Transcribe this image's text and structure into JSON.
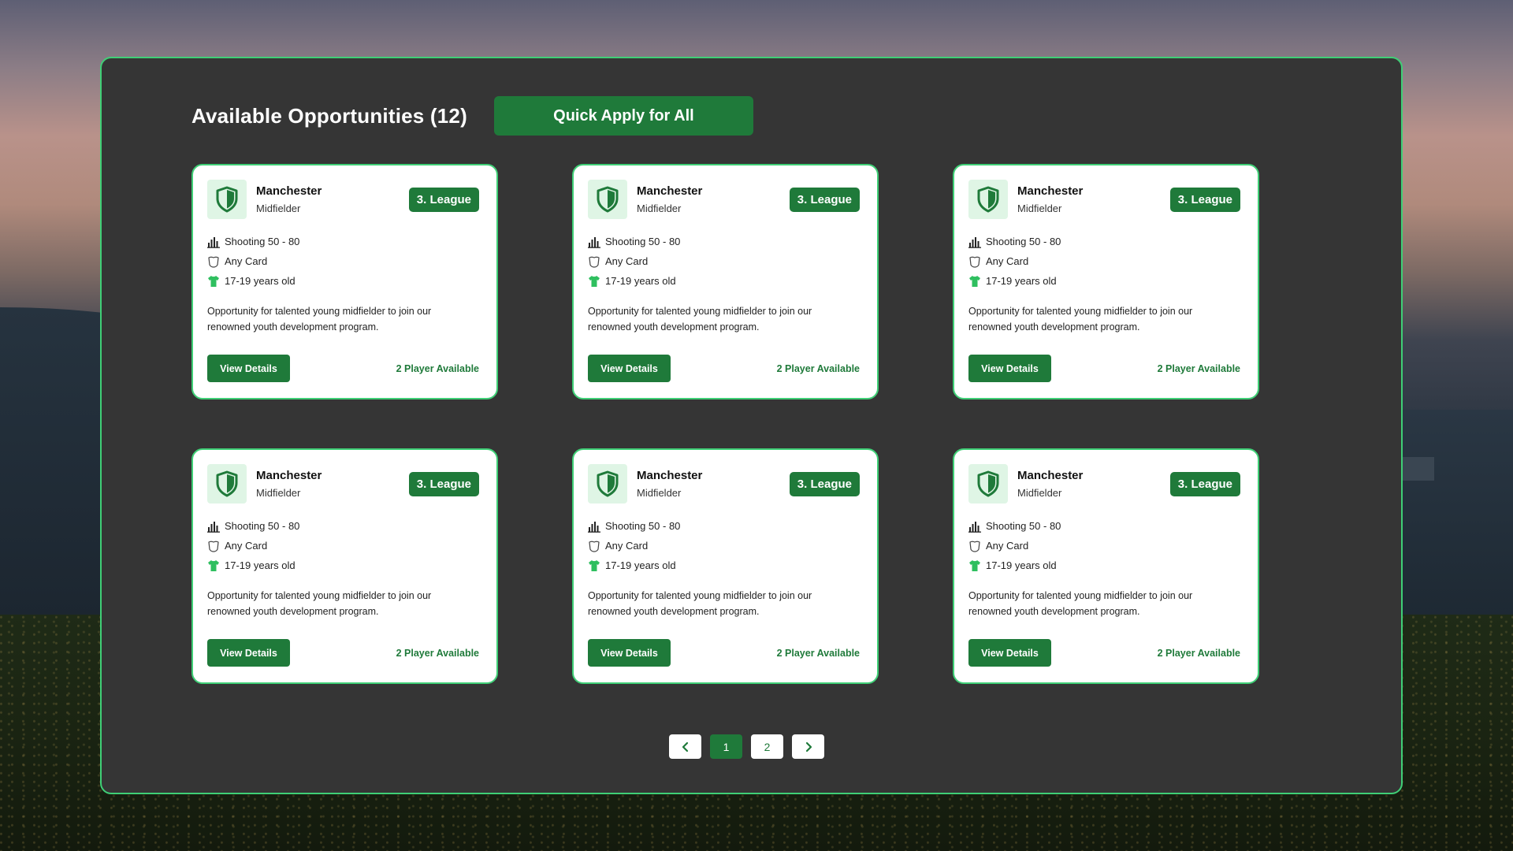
{
  "page": {
    "title": "Available Opportunities (12)",
    "quick_apply_label": "Quick Apply for All"
  },
  "colors": {
    "accent": "#1f7a3a",
    "border": "#3fcf76",
    "panel_bg": "#353535"
  },
  "cards": [
    {
      "club": "Manchester",
      "position": "Midfielder",
      "league": "3. League",
      "shooting": "Shooting 50 - 80",
      "card_type": "Any Card",
      "age": "17-19 years old",
      "description": "Opportunity for talented young midfielder to join our renowned youth development program.",
      "view_label": "View Details",
      "availability": "2 Player Available"
    },
    {
      "club": "Manchester",
      "position": "Midfielder",
      "league": "3. League",
      "shooting": "Shooting 50 - 80",
      "card_type": "Any Card",
      "age": "17-19 years old",
      "description": "Opportunity for talented young midfielder to join our renowned youth development program.",
      "view_label": "View Details",
      "availability": "2 Player Available"
    },
    {
      "club": "Manchester",
      "position": "Midfielder",
      "league": "3. League",
      "shooting": "Shooting 50 - 80",
      "card_type": "Any Card",
      "age": "17-19 years old",
      "description": "Opportunity for talented young midfielder to join our renowned youth development program.",
      "view_label": "View Details",
      "availability": "2 Player Available"
    },
    {
      "club": "Manchester",
      "position": "Midfielder",
      "league": "3. League",
      "shooting": "Shooting 50 - 80",
      "card_type": "Any Card",
      "age": "17-19 years old",
      "description": "Opportunity for talented young midfielder to join our renowned youth development program.",
      "view_label": "View Details",
      "availability": "2 Player Available"
    },
    {
      "club": "Manchester",
      "position": "Midfielder",
      "league": "3. League",
      "shooting": "Shooting 50 - 80",
      "card_type": "Any Card",
      "age": "17-19 years old",
      "description": "Opportunity for talented young midfielder to join our renowned youth development program.",
      "view_label": "View Details",
      "availability": "2 Player Available"
    },
    {
      "club": "Manchester",
      "position": "Midfielder",
      "league": "3. League",
      "shooting": "Shooting 50 - 80",
      "card_type": "Any Card",
      "age": "17-19 years old",
      "description": "Opportunity for talented young midfielder to join our renowned youth development program.",
      "view_label": "View Details",
      "availability": "2 Player Available"
    }
  ],
  "icons": {
    "club": "shield-icon",
    "shooting": "bar-chart-icon",
    "card": "card-icon",
    "age": "shirt-icon",
    "prev": "chevron-left-icon",
    "next": "chevron-right-icon"
  },
  "pagination": {
    "pages": [
      "1",
      "2"
    ],
    "current": "1"
  }
}
